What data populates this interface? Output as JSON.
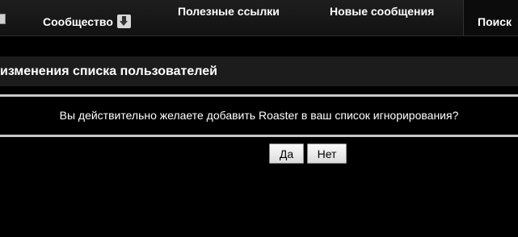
{
  "nav": {
    "community": "Сообщество",
    "community_icon": "download-arrow-icon",
    "useful_links": "Полезные ссылки",
    "new_posts": "Новые сообщения",
    "search": "Поиск"
  },
  "page": {
    "title": "изменения списка пользователей"
  },
  "dialog": {
    "question": "Вы действительно желаете добавить Roaster в ваш список игнорирования?",
    "yes_label": "Да",
    "no_label": "Нет"
  },
  "colors": {
    "background": "#000000",
    "navbar": "#1a1a1a",
    "title_bar": "#1c1c1c",
    "divider": "#c8c8c8"
  }
}
